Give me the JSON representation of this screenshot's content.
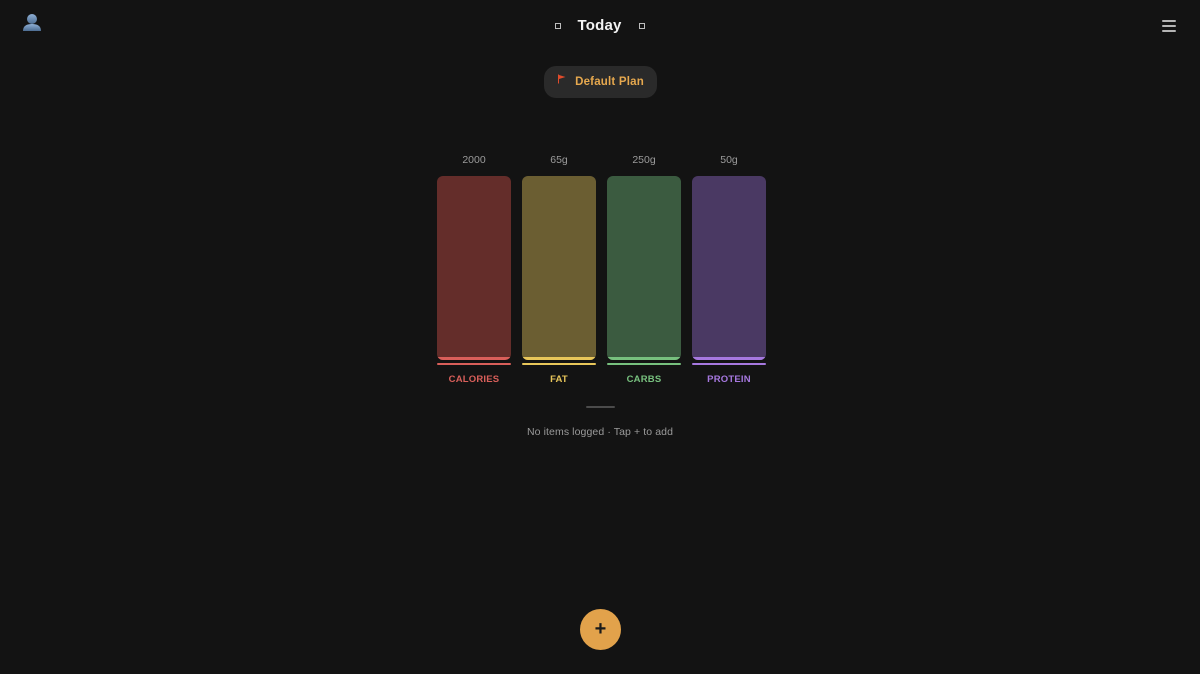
{
  "header": {
    "title": "Today",
    "avatar_icon": "user-avatar-icon",
    "menu_icon": "hamburger-menu-icon",
    "prev_icon": "prev-day-icon",
    "next_icon": "next-day-icon"
  },
  "plan": {
    "label": "Default Plan",
    "flag_icon": "red-flag-icon",
    "flag_color": "#e04b2b",
    "label_color": "#e6a84e"
  },
  "macros": [
    {
      "key": "calories",
      "label": "CALORIES",
      "goal": "2000",
      "logged_fraction": 0,
      "fill_color": "#642d2a",
      "accent_color": "#d95f5a"
    },
    {
      "key": "fat",
      "label": "FAT",
      "goal": "65g",
      "logged_fraction": 0,
      "fill_color": "#6b5e32",
      "accent_color": "#e8c65a"
    },
    {
      "key": "carbs",
      "label": "CARBS",
      "goal": "250g",
      "logged_fraction": 0,
      "fill_color": "#3b5b40",
      "accent_color": "#77c07e"
    },
    {
      "key": "protein",
      "label": "PROTEIN",
      "goal": "50g",
      "logged_fraction": 0,
      "fill_color": "#4a3963",
      "accent_color": "#a678df"
    }
  ],
  "log": {
    "empty_message": "No items logged · Tap + to add"
  },
  "fab": {
    "label": "+",
    "icon": "plus-icon",
    "color": "#e2a24b"
  }
}
